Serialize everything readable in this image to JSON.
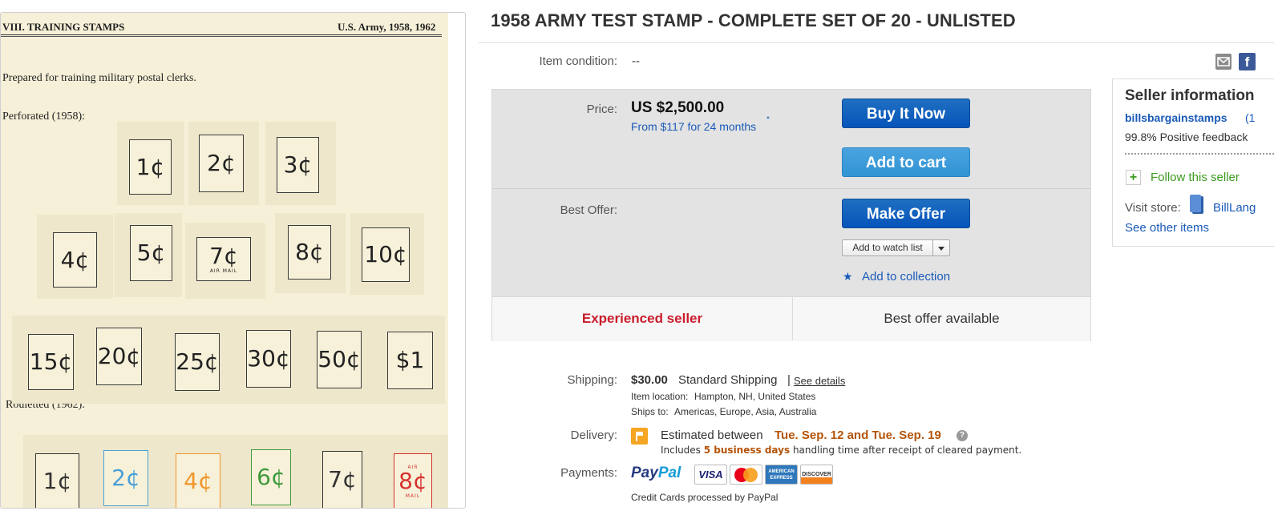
{
  "listing": {
    "title": "1958 ARMY TEST STAMP - COMPLETE SET OF 20 - UNLISTED"
  },
  "image": {
    "header_left": "VIII.  TRAINING STAMPS",
    "header_right": "U.S. Army, 1958, 1962",
    "caption": "Prepared for training military postal clerks.",
    "perforated_label": "Perforated (1958):",
    "rouletted_label": "Rouletted (1962):",
    "perforated_row1": [
      "1¢",
      "2¢",
      "3¢"
    ],
    "perforated_row2": [
      "4¢",
      "5¢",
      "7¢",
      "8¢",
      "10¢"
    ],
    "perforated_row2_sub": "AIR MAIL",
    "perforated_row3": [
      "15¢",
      "20¢",
      "25¢",
      "30¢",
      "50¢",
      "$1"
    ],
    "rouletted_row": [
      "1¢",
      "2¢",
      "4¢",
      "6¢",
      "7¢",
      "8¢"
    ],
    "rouletted_air": "AIR",
    "rouletted_mail": "MAIL",
    "rouletted_colors": [
      "#333333",
      "#4a9fd6",
      "#f0962a",
      "#3f9a3a",
      "#333333",
      "#d6322f"
    ]
  },
  "condition": {
    "label": "Item condition:",
    "value": "--"
  },
  "price": {
    "label": "Price:",
    "value": "US $2,500.00",
    "financing": "From $117 for 24 months",
    "financing_mark": "*"
  },
  "actions": {
    "buy_it_now": "Buy It Now",
    "add_to_cart": "Add to cart",
    "make_offer": "Make Offer",
    "watch_list": "Add to watch list",
    "add_to_collection": "Add to collection",
    "collection_icon": "★"
  },
  "best_offer": {
    "label": "Best Offer:"
  },
  "signals": {
    "experienced_seller": "Experienced seller",
    "best_offer_available": "Best offer available"
  },
  "shipping": {
    "label": "Shipping:",
    "price": "$30.00",
    "service": "Standard Shipping",
    "separator": "|",
    "see_details": "See details",
    "item_location_label": "Item location:",
    "item_location": "Hampton, NH, United States",
    "ships_to_label": "Ships to:",
    "ships_to": "Americas, Europe, Asia, Australia"
  },
  "delivery": {
    "label": "Delivery:",
    "estimate_prefix": "Estimated between",
    "estimate_dates": "Tue. Sep. 12 and Tue. Sep. 19",
    "help": "?",
    "handling_prefix": "Includes",
    "handling_days": "5 business days",
    "handling_suffix": "handling time after receipt of cleared payment."
  },
  "payments": {
    "label": "Payments:",
    "paypal_part1": "Pay",
    "paypal_part2": "Pal",
    "visa": "VISA",
    "amex_line1": "AMERICAN",
    "amex_line2": "EXPRESS",
    "discover": "DISCOVER",
    "note": "Credit Cards processed by PayPal"
  },
  "share": {
    "facebook": "f"
  },
  "seller": {
    "title": "Seller information",
    "name": "billsbargainstamps",
    "feedback_score": "(1",
    "feedback": "99.8% Positive feedback",
    "follow_icon": "+",
    "follow": "Follow this seller",
    "visit_store_label": "Visit store:",
    "store_name": "BillLang",
    "see_other_items": "See other items"
  },
  "colors": {
    "primary_button": "#0654ba",
    "secondary_button": "#3194d3",
    "link": "#1a5ab8",
    "alert_red": "#c91c2b",
    "delivery_orange": "#b45309",
    "follow_green": "#3c9a1f"
  }
}
